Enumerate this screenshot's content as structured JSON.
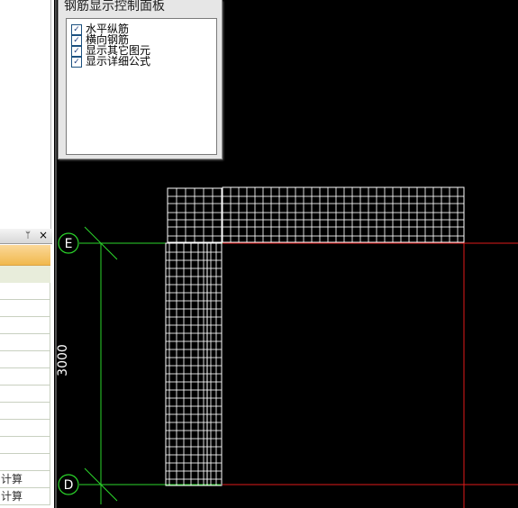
{
  "control_panel": {
    "title": "钢筋显示控制面板",
    "checkboxes": [
      {
        "label": "水平纵筋",
        "checked": true
      },
      {
        "label": "横向钢筋",
        "checked": true
      },
      {
        "label": "显示其它图元",
        "checked": true
      },
      {
        "label": "显示详细公式",
        "checked": true
      }
    ]
  },
  "side_panel": {
    "pin_glyph": "ᛘ",
    "close_glyph": "×",
    "rows": [
      {
        "label": "计算"
      },
      {
        "label": "计算"
      }
    ]
  },
  "drawing": {
    "axis_labels": [
      "E",
      "D"
    ],
    "dimension_text": "3000",
    "colors": {
      "background": "#000000",
      "axis_green": "#2bd62b",
      "axis_red": "#e01a1a",
      "rebar": "#ffffff"
    }
  }
}
